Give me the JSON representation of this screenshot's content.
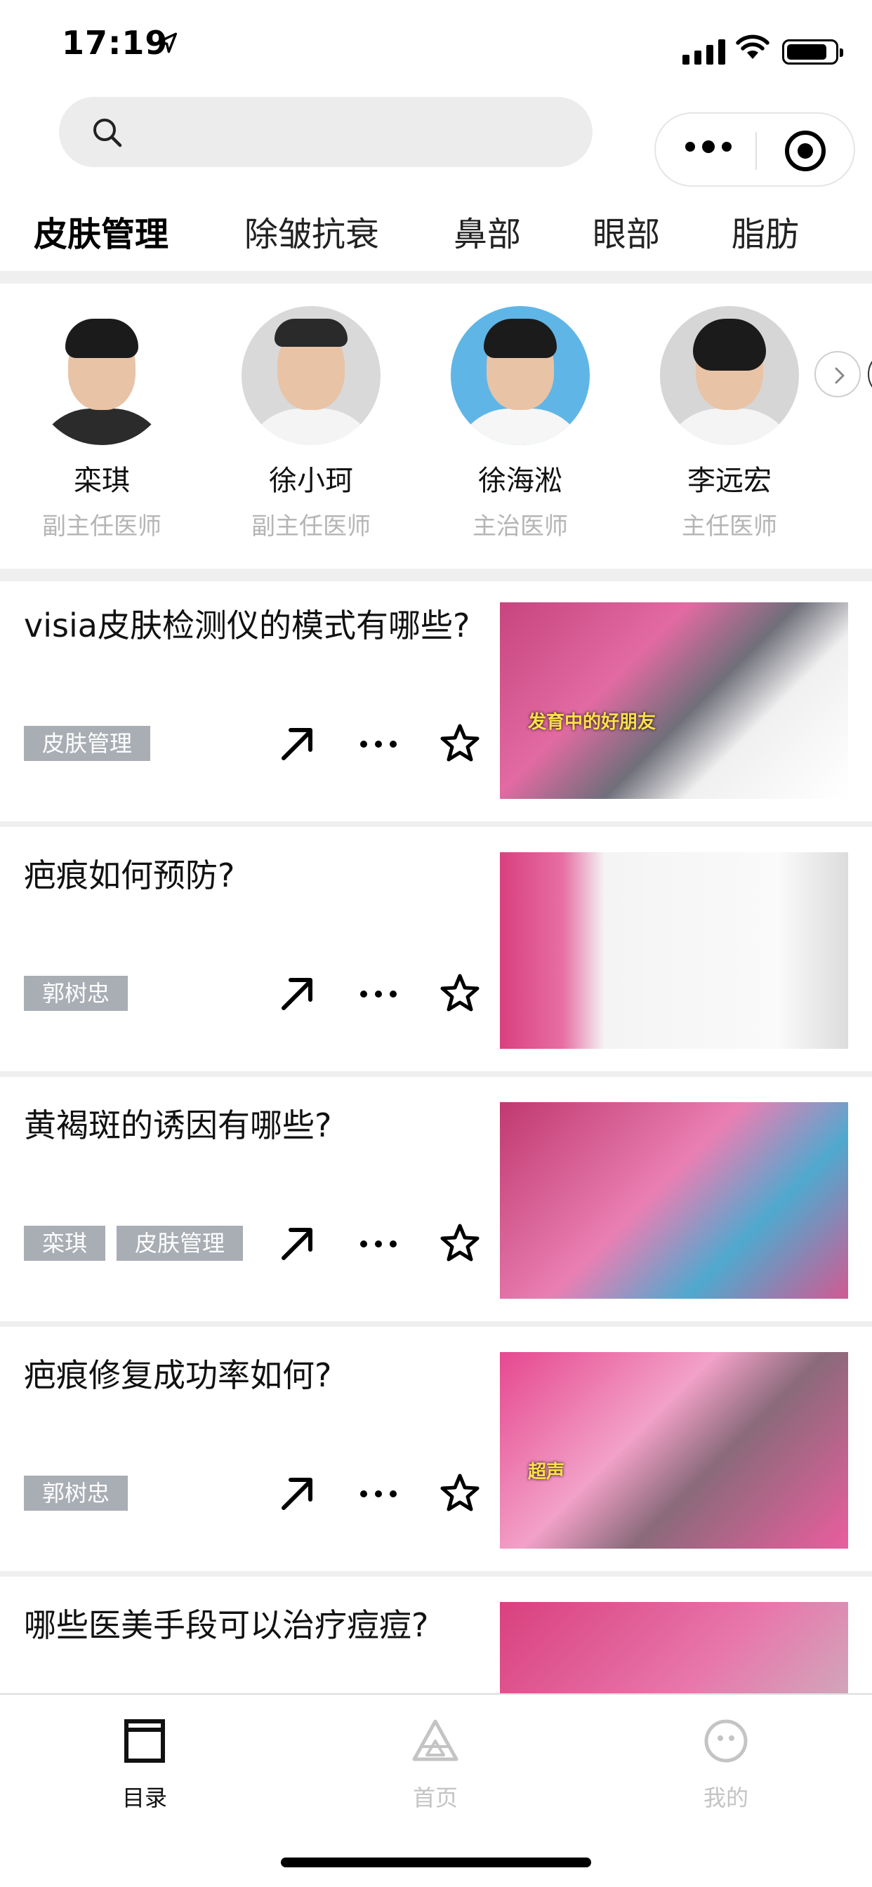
{
  "status_bar": {
    "time": "17:19",
    "battery_level": 0.85
  },
  "search": {
    "placeholder": ""
  },
  "tabs": [
    {
      "label": "皮肤管理",
      "active": true
    },
    {
      "label": "除皱抗衰",
      "active": false
    },
    {
      "label": "鼻部",
      "active": false
    },
    {
      "label": "眼部",
      "active": false
    },
    {
      "label": "脂肪",
      "active": false
    }
  ],
  "doctors": [
    {
      "name": "栾琪",
      "title": "副主任医师"
    },
    {
      "name": "徐小珂",
      "title": "副主任医师"
    },
    {
      "name": "徐海淞",
      "title": "主治医师"
    },
    {
      "name": "李远宏",
      "title": "主任医师"
    }
  ],
  "articles": [
    {
      "title": "visia皮肤检测仪的模式有哪些?",
      "tags": [
        "皮肤管理"
      ],
      "thumb_text": "发育中的好朋友"
    },
    {
      "title": "疤痕如何预防?",
      "tags": [
        "郭树忠"
      ],
      "thumb_text": ""
    },
    {
      "title": "黄褐斑的诱因有哪些?",
      "tags": [
        "栾琪",
        "皮肤管理"
      ],
      "thumb_text": ""
    },
    {
      "title": "疤痕修复成功率如何?",
      "tags": [
        "郭树忠"
      ],
      "thumb_text": "超声"
    },
    {
      "title": "哪些医美手段可以治疗痘痘?",
      "tags": [],
      "thumb_text": ""
    }
  ],
  "tabbar": [
    {
      "label": "目录",
      "active": true
    },
    {
      "label": "首页",
      "active": false
    },
    {
      "label": "我的",
      "active": false
    }
  ],
  "colors": {
    "tag_bg": "#a9adb4",
    "tab_inactive": "#c4c4c4",
    "pink": "#e8559a"
  }
}
